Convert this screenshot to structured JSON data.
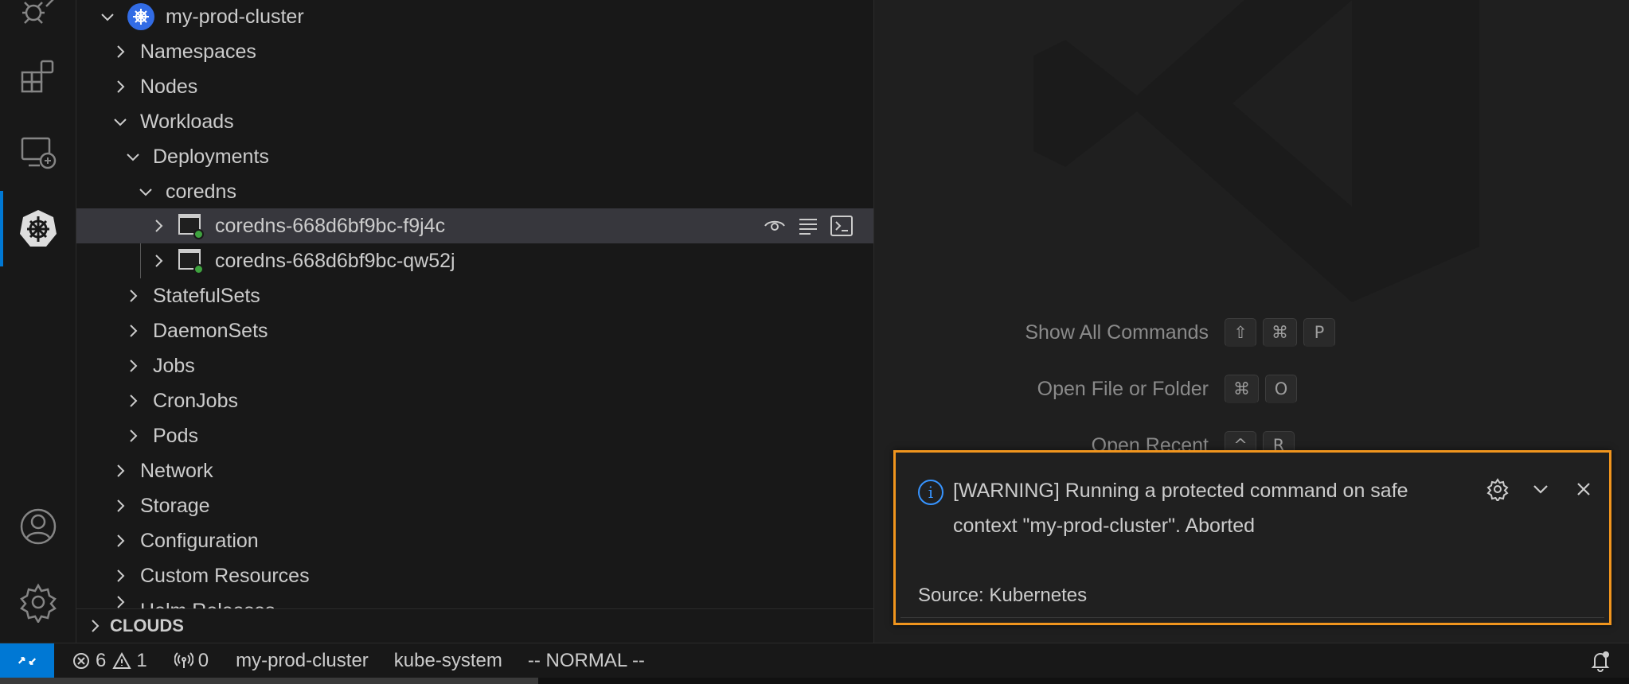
{
  "activity_bar": {
    "icons": [
      "debug-icon",
      "extensions-icon",
      "remote-explorer-icon",
      "kubernetes-icon",
      "account-icon",
      "settings-gear-icon"
    ],
    "accent_color": "#0078d4"
  },
  "tree": {
    "cluster": "my-prod-cluster",
    "namespaces": "Namespaces",
    "nodes": "Nodes",
    "workloads": "Workloads",
    "deployments": "Deployments",
    "coredns": "coredns",
    "pod1": "coredns-668d6bf9bc-f9j4c",
    "pod2": "coredns-668d6bf9bc-qw52j",
    "statefulsets": "StatefulSets",
    "daemonsets": "DaemonSets",
    "jobs": "Jobs",
    "cronjobs": "CronJobs",
    "pods": "Pods",
    "network": "Network",
    "storage": "Storage",
    "configuration": "Configuration",
    "custom_resources": "Custom Resources",
    "helm_releases_partial": "Helm Releases"
  },
  "clouds_header": "CLOUDS",
  "welcome": {
    "show_all_commands": "Show All Commands",
    "show_all_keys": [
      "⇧",
      "⌘",
      "P"
    ],
    "open_file": "Open File or Folder",
    "open_file_keys": [
      "⌘",
      "O"
    ],
    "open_recent": "Open Recent",
    "open_recent_keys": [
      "^",
      "R"
    ]
  },
  "notification": {
    "message_line1": "[WARNING] Running a protected command on safe",
    "message_line2": "context \"my-prod-cluster\". Aborted",
    "source": "Source: Kubernetes",
    "highlight_color": "#f0951e"
  },
  "status_bar": {
    "errors": "6",
    "warnings": "1",
    "ports": "0",
    "context": "my-prod-cluster",
    "namespace": "kube-system",
    "mode": "-- NORMAL --"
  }
}
